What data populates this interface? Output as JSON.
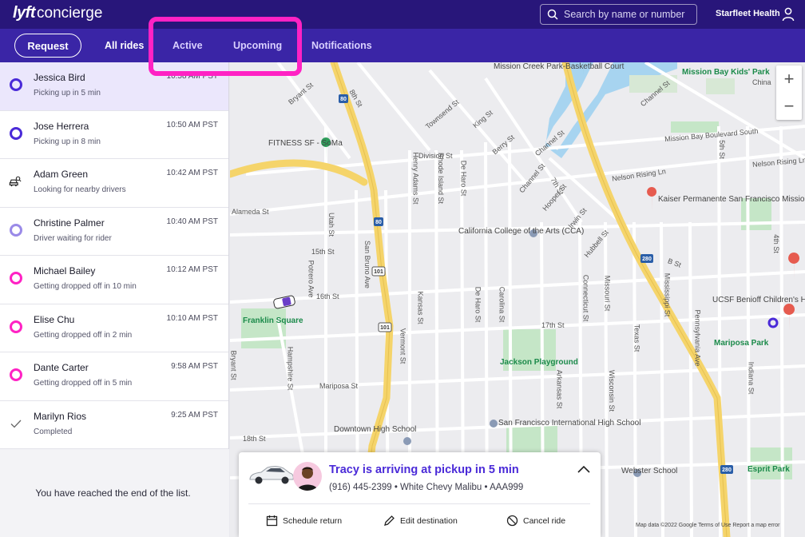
{
  "app": {
    "logo_mark": "lyft",
    "logo_word": "concierge",
    "organization": "Starfleet Health"
  },
  "search": {
    "placeholder": "Search by name or number"
  },
  "nav": {
    "request_label": "Request",
    "tabs": [
      "All rides",
      "Active",
      "Upcoming",
      "Notifications"
    ]
  },
  "rides": [
    {
      "name": "Jessica Bird",
      "status": "Picking up in 5 min",
      "time": "10:58 AM PST",
      "icon": "ring-indigo",
      "selected": true
    },
    {
      "name": "Jose Herrera",
      "status": "Picking up in 8 min",
      "time": "10:50 AM PST",
      "icon": "ring-indigo"
    },
    {
      "name": "Adam Green",
      "status": "Looking for nearby drivers",
      "time": "10:42 AM PST",
      "icon": "car-search-icon"
    },
    {
      "name": "Christine Palmer",
      "status": "Driver waiting for rider",
      "time": "10:40 AM PST",
      "icon": "ring-lavender"
    },
    {
      "name": "Michael Bailey",
      "status": "Getting dropped off in 10 min",
      "time": "10:12 AM PST",
      "icon": "ring-magenta"
    },
    {
      "name": "Elise Chu",
      "status": "Getting dropped off in 2 min",
      "time": "10:10 AM PST",
      "icon": "ring-magenta"
    },
    {
      "name": "Dante Carter",
      "status": "Getting dropped off in 5 min",
      "time": "9:58 AM PST",
      "icon": "ring-magenta"
    },
    {
      "name": "Marilyn Rios",
      "status": "Completed",
      "time": "9:25 AM PST",
      "icon": "check-icon"
    }
  ],
  "list_end": "You have reached the end of the list.",
  "colors": {
    "topbar": "#28167a",
    "navbar": "#3a25a6",
    "accent": "#4a2ad8",
    "magenta": "#ff22c4",
    "indigo": "#4a2ad8",
    "lavender": "#9a8ae8"
  },
  "map": {
    "streets": [
      "Bryant St",
      "8th St",
      "Townsend St",
      "King St",
      "Berry St",
      "Channel St",
      "Division St",
      "Henry Adams St",
      "Rhode Island St",
      "De Haro St",
      "Channel St",
      "7th St",
      "Hooper St",
      "Irwin St",
      "Hubbell St",
      "Alameda St",
      "15th St",
      "Utah St",
      "San Bruno Ave",
      "Potrero Ave",
      "16th St",
      "Kansas St",
      "De Haro St",
      "Carolina St",
      "Connecticut St",
      "Missouri St",
      "Mississippi St",
      "Texas St",
      "17th St",
      "Vermont St",
      "Arkansas St",
      "Pennsylvania Ave",
      "Bryant St",
      "Hampshire St",
      "Mariposa St",
      "Wisconsin St",
      "18th St",
      "Indiana St",
      "Nelson Rising Ln",
      "Nelson Rising Ln",
      "Mission Bay Boulevard South",
      "Channel St",
      "5th St",
      "4th St",
      "B St",
      "China"
    ],
    "places": [
      "Mission Creek Park-Basketball Court",
      "Mission Bay Kids' Park",
      "FITNESS SF - SoMa",
      "Kaiser Permanente San Francisco Mission...",
      "California College of the Arts (CCA)",
      "Franklin Square",
      "Jackson Playground",
      "UCSF Benioff Children's Hospital - San Francisco",
      "Mariposa Park",
      "Downtown High School",
      "San Francisco International High School",
      "Webster School",
      "Esprit Park"
    ],
    "highway_shields": [
      "80",
      "80",
      "101",
      "101",
      "280",
      "280"
    ],
    "attribution": "Map data ©2022 Google   Terms of Use   Report a map error"
  },
  "ride_card": {
    "title": "Tracy is arriving at pickup in 5 min",
    "phone": "(916) 445-2399",
    "car": "White Chevy Malibu",
    "plate": "AAA999",
    "details_line": "(916) 445-2399  •  White Chevy Malibu  •  AAA999",
    "actions": [
      "Schedule return",
      "Edit destination",
      "Cancel ride"
    ]
  }
}
